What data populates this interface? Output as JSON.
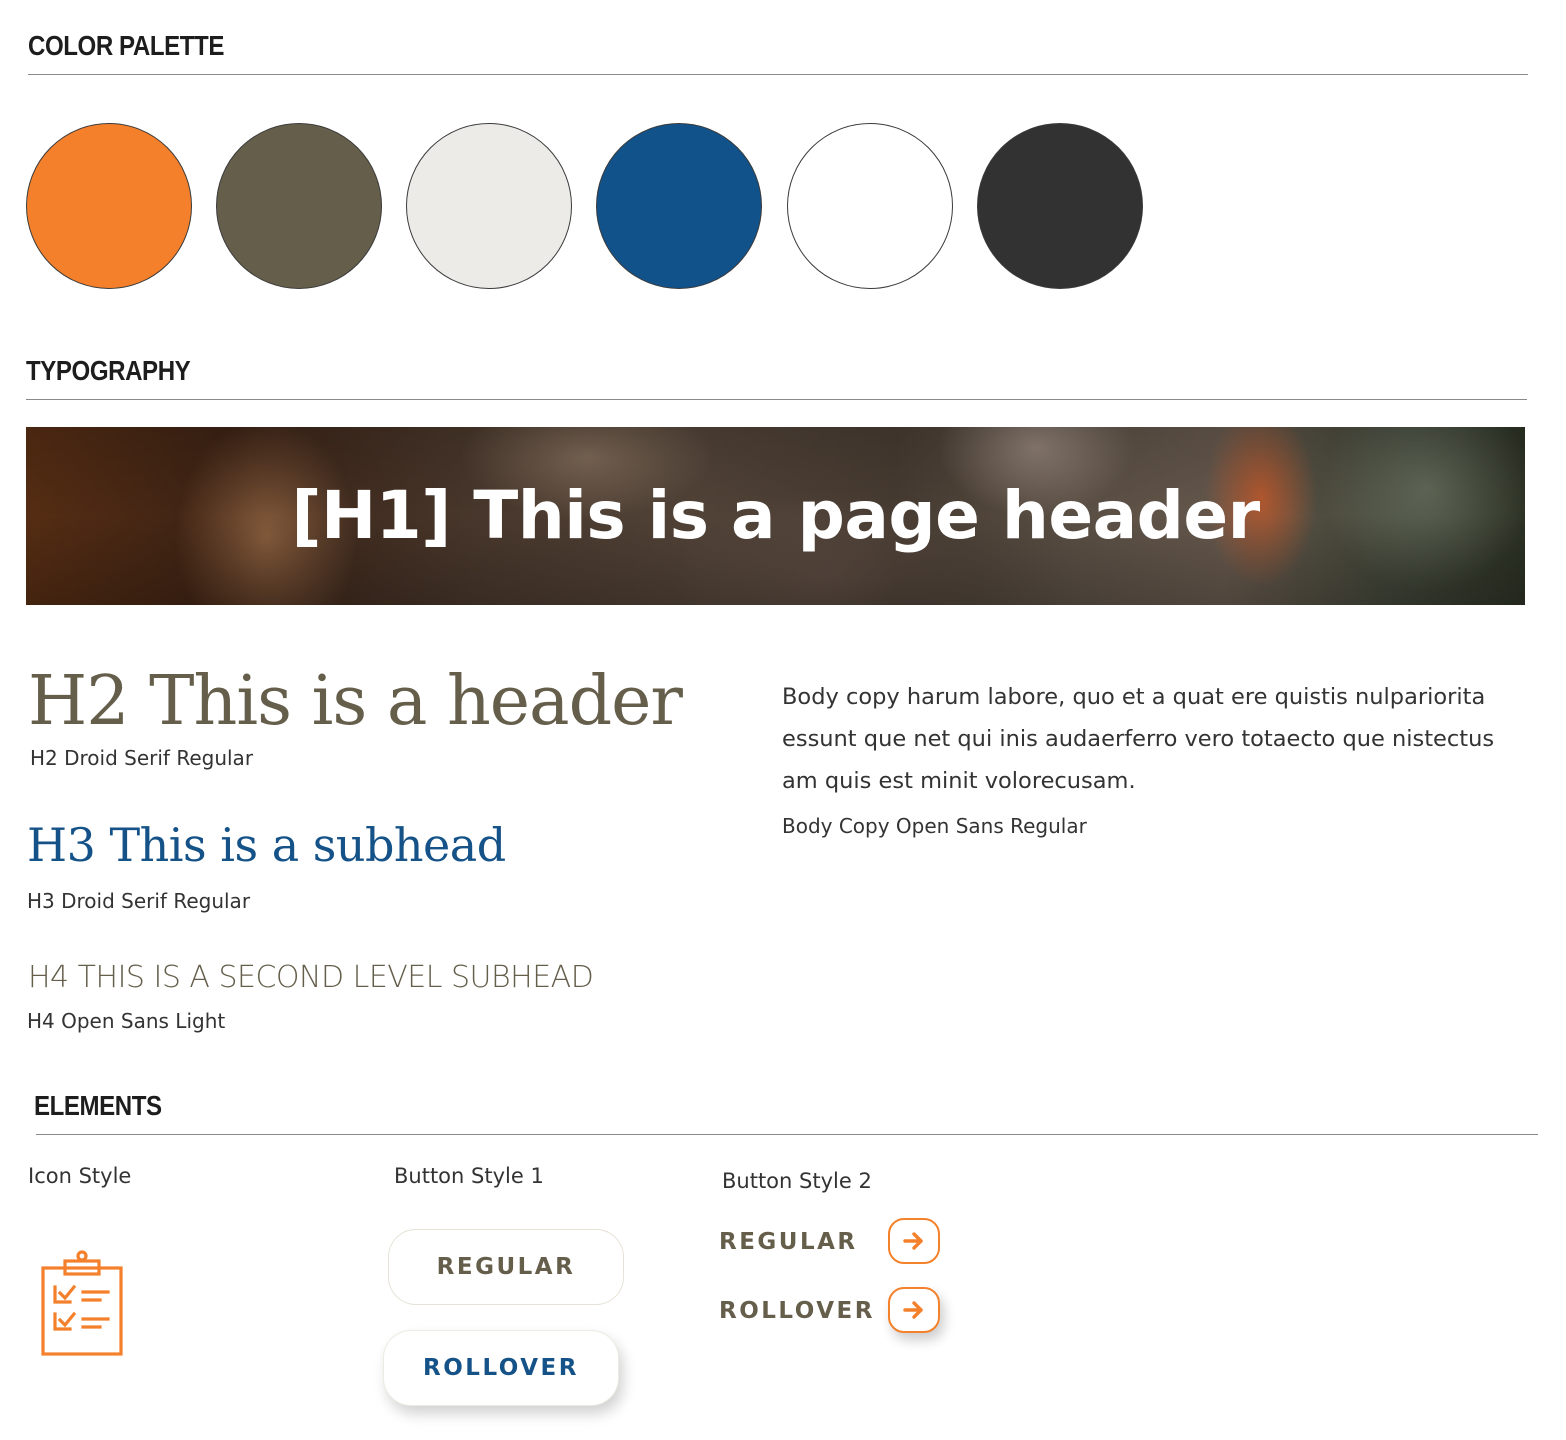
{
  "sections": {
    "palette_title": "COLOR PALETTE",
    "typography_title": "TYPOGRAPHY",
    "elements_title": "ELEMENTS"
  },
  "palette": [
    {
      "color": "#f4802b"
    },
    {
      "color": "#655e4b"
    },
    {
      "color": "#ecebe8"
    },
    {
      "color": "#11528b"
    },
    {
      "color": "#ffffff"
    },
    {
      "color": "#323232"
    }
  ],
  "typography": {
    "h1": "[H1] This is a page header",
    "h2": "H2 This is a header",
    "h2_caption": "H2 Droid Serif Regular",
    "h3": "H3 This is a subhead",
    "h3_caption": "H3 Droid Serif Regular",
    "h4": "H4 THIS IS A SECOND LEVEL SUBHEAD",
    "h4_caption": "H4 Open Sans Light",
    "body": "Body copy harum labore, quo et a quat ere quistis nulpariorita essunt que net qui inis audaerferro vero totaecto que nistectus am quis est minit volorecusam.",
    "body_caption": "Body Copy Open Sans Regular"
  },
  "elements": {
    "icon_style_label": "Icon Style",
    "icon": "clipboard-checklist-icon",
    "button_style_1_label": "Button Style 1",
    "button_style_1_regular": "REGULAR",
    "button_style_1_rollover": "ROLLOVER",
    "button_style_2_label": "Button Style 2",
    "button_style_2_regular": "REGULAR",
    "button_style_2_rollover": "ROLLOVER",
    "arrow_icon": "arrow-right-icon"
  },
  "colors": {
    "accent_orange": "#f4802b",
    "brown": "#655e4b",
    "blue": "#145288"
  }
}
